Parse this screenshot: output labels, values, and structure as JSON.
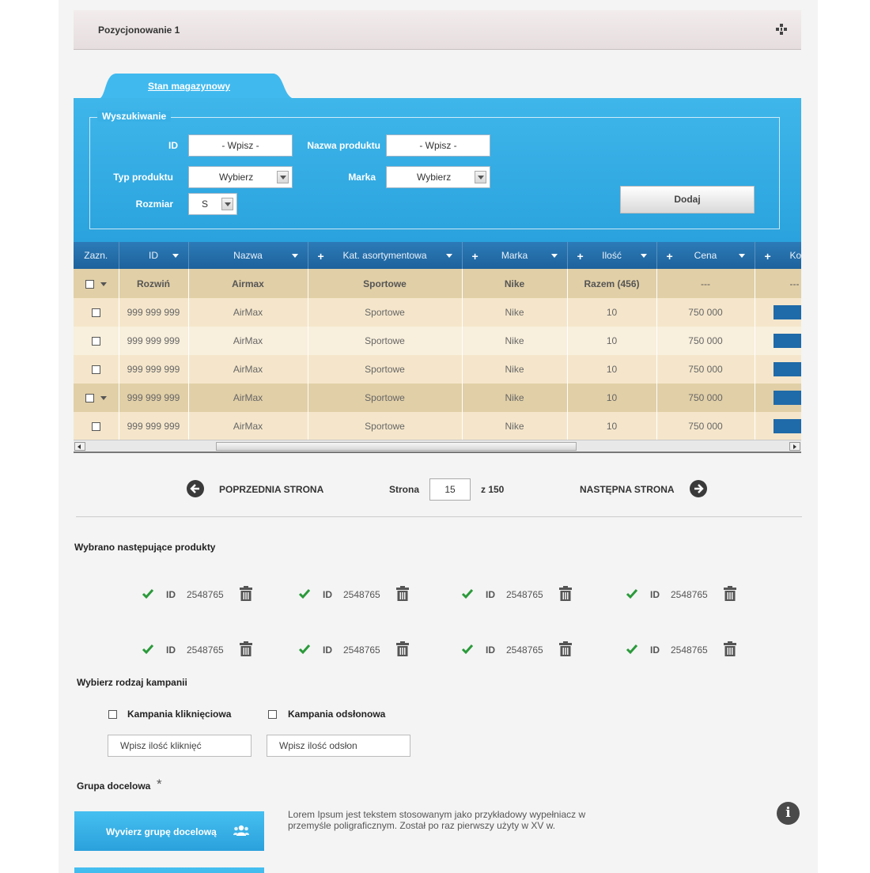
{
  "header": {
    "title": "Pozycjonowanie 1",
    "move_icon": "move-cross-icon"
  },
  "tab": {
    "label": "Stan magazynowy"
  },
  "search": {
    "legend": "Wyszukiwanie",
    "id_label": "ID",
    "id_value": "- Wpisz -",
    "name_label": "Nazwa produktu",
    "name_value": "- Wpisz -",
    "type_label": "Typ produktu",
    "type_value": "Wybierz",
    "brand_label": "Marka",
    "brand_value": "Wybierz",
    "size_label": "Rozmiar",
    "size_value": "S",
    "add_button": "Dodaj"
  },
  "table": {
    "headers": [
      "Zazn.",
      "ID",
      "Nazwa",
      "Kat. asortymentowa",
      "Marka",
      "Ilość",
      "Cena",
      "Ko"
    ],
    "summary": {
      "expand": "Rozwiń",
      "name": "Airmax",
      "category": "Sportowe",
      "brand": "Nike",
      "qty": "Razem  (456)",
      "price": "---",
      "extra": "---"
    },
    "rows": [
      {
        "id": "999 999 999",
        "name": "AirMax",
        "category": "Sportowe",
        "brand": "Nike",
        "qty": "10",
        "price": "750 000"
      },
      {
        "id": "999 999 999",
        "name": "AirMax",
        "category": "Sportowe",
        "brand": "Nike",
        "qty": "10",
        "price": "750 000"
      },
      {
        "id": "999 999 999",
        "name": "AirMax",
        "category": "Sportowe",
        "brand": "Nike",
        "qty": "10",
        "price": "750 000"
      },
      {
        "id": "999 999 999",
        "name": "AirMax",
        "category": "Sportowe",
        "brand": "Nike",
        "qty": "10",
        "price": "750 000"
      },
      {
        "id": "999 999 999",
        "name": "AirMax",
        "category": "Sportowe",
        "brand": "Nike",
        "qty": "10",
        "price": "750 000"
      }
    ]
  },
  "pagination": {
    "prev": "POPRZEDNIA STRONA",
    "page_label": "Strona",
    "page_value": "15",
    "of": "z 150",
    "next": "NASTĘPNA STRONA"
  },
  "selected": {
    "title": "Wybrano następujące produkty",
    "items": [
      {
        "label": "ID",
        "value": "2548765"
      },
      {
        "label": "ID",
        "value": "2548765"
      },
      {
        "label": "ID",
        "value": "2548765"
      },
      {
        "label": "ID",
        "value": "2548765"
      },
      {
        "label": "ID",
        "value": "2548765"
      },
      {
        "label": "ID",
        "value": "2548765"
      },
      {
        "label": "ID",
        "value": "2548765"
      },
      {
        "label": "ID",
        "value": "2548765"
      }
    ]
  },
  "campaign": {
    "title": "Wybierz rodzaj kampanii",
    "click_label": "Kampania kliknięciowa",
    "view_label": "Kampania odsłonowa",
    "click_input": "Wpisz ilość kliknięć",
    "view_input": "Wpisz ilość odsłon"
  },
  "target": {
    "title": "Grupa docelowa",
    "required_mark": "*",
    "button": "Wyvierz grupę docelową",
    "description": "Lorem Ipsum jest tekstem stosowanym jako przykładowy wypełniacz w przemyśle poligraficznym. Został po raz pierwszy użyty w XV w.",
    "info": "i"
  },
  "colors": {
    "accent_blue": "#2aa2dd",
    "table_header": "#1d629c",
    "check_green": "#2a9a3a"
  }
}
